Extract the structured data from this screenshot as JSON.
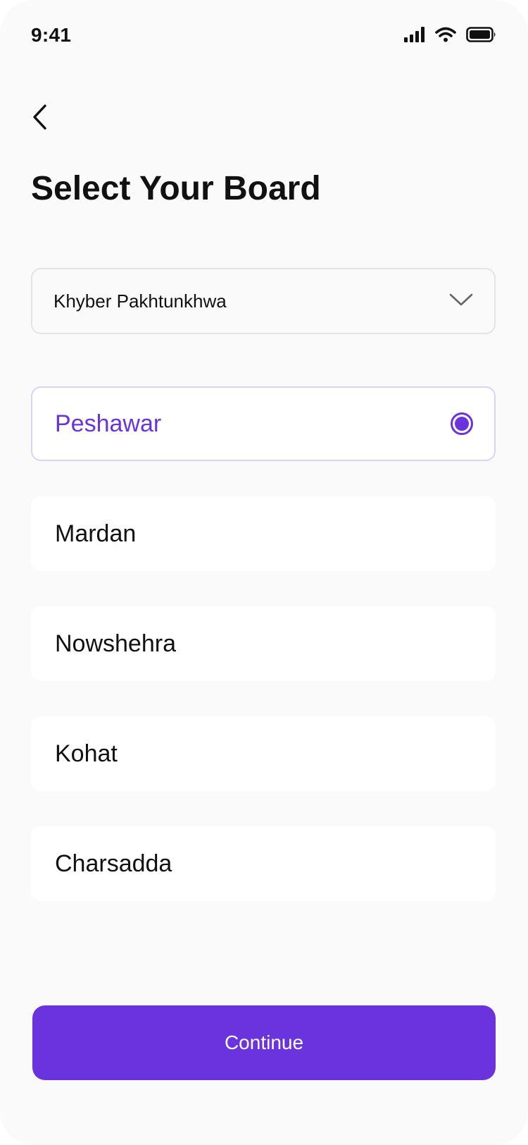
{
  "status_bar": {
    "time": "9:41",
    "icons": [
      "cellular-signal-icon",
      "wifi-icon",
      "battery-icon"
    ]
  },
  "header": {
    "back_icon": "chevron-left-icon",
    "title": "Select Your Board"
  },
  "region_select": {
    "value": "Khyber Pakhtunkhwa",
    "icon": "chevron-down-icon"
  },
  "boards": [
    {
      "label": "Peshawar",
      "selected": true
    },
    {
      "label": "Mardan",
      "selected": false
    },
    {
      "label": "Nowshehra",
      "selected": false
    },
    {
      "label": "Kohat",
      "selected": false
    },
    {
      "label": "Charsadda",
      "selected": false
    }
  ],
  "actions": {
    "continue_label": "Continue"
  },
  "colors": {
    "accent": "#6B33DD",
    "background": "#FAFAFA",
    "card": "#FFFFFF",
    "text": "#111111",
    "selected_border": "#DCD2F5"
  }
}
